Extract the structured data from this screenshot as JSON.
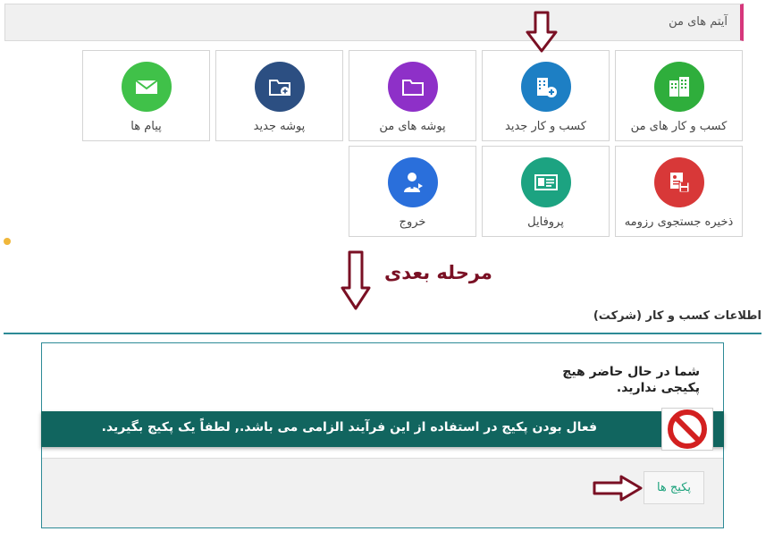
{
  "header": {
    "title": "آیتم های من"
  },
  "tiles": [
    {
      "label": "کسب و کار های من",
      "color": "#2fae3c",
      "icon": "buildings-icon"
    },
    {
      "label": "کسب و کار جدید",
      "color": "#1d7fc4",
      "icon": "building-add-icon"
    },
    {
      "label": "پوشه های من",
      "color": "#8e30c8",
      "icon": "folder-icon"
    },
    {
      "label": "پوشه جدید",
      "color": "#2c4f82",
      "icon": "folder-add-icon"
    },
    {
      "label": "پیام ها",
      "color": "#40c149",
      "icon": "envelope-icon"
    },
    {
      "label": "ذخیره جستجوی رزومه",
      "color": "#d83838",
      "icon": "resume-save-icon"
    },
    {
      "label": "پروفایل",
      "color": "#1ca381",
      "icon": "id-card-icon"
    },
    {
      "label": "خروج",
      "color": "#2a6fdb",
      "icon": "user-exit-icon"
    }
  ],
  "next_step": {
    "label": "مرحله بعدی"
  },
  "section": {
    "title": "اطلاعات کسب و کار (شرکت)"
  },
  "notice": {
    "text": "شما در حال حاضر هیچ پکیجی ندارید."
  },
  "alert": {
    "text": "فعال بودن پکیج در استفاده از این فرآیند الزامی می باشد., لطفاً یک پکیج بگیرید."
  },
  "packages_button": {
    "label": "پکیج ها"
  },
  "colors": {
    "accent": "#d6377b",
    "teal": "#2d8a96",
    "alert_bg": "#11655f",
    "arrow": "#7a1024"
  }
}
